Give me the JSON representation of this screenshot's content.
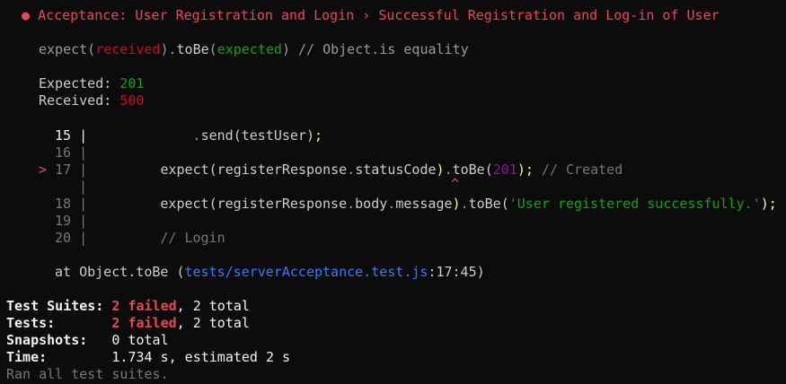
{
  "header": {
    "bullet": "●",
    "title": "Acceptance: User Registration and Login › Successful Registration and Log-in of User"
  },
  "matcher": {
    "expect": "expect(",
    "received": "received",
    "close_dot": ").",
    "tobe": "toBe",
    "open": "(",
    "expected": "expected",
    "close": ")",
    "comment": " // Object.is equality"
  },
  "values": {
    "expected_label": "Expected: ",
    "expected_value": "201",
    "received_label": "Received: ",
    "received_value": "500"
  },
  "code": {
    "line15_no": "15 |",
    "line15_dot": ".",
    "line15_send": "send",
    "line15_rest": "(testUser)",
    "line15_semi": ";",
    "line16_no": "16 |",
    "line17_marker": ">",
    "line17_no": "17 |",
    "line17_expect": "expect(registerResponse",
    "line17_dot1": ".",
    "line17_status": "statusCode",
    "line17_paren": ")",
    "line17_dot2": ".",
    "line17_tobe": "toBe(",
    "line17_num": "201",
    "line17_close": ");",
    "line17_comment": " // Created",
    "caret_gutter": "|",
    "caret": "^",
    "line18_no": "18 |",
    "line18_expect": "expect(registerResponse",
    "line18_dot1": ".",
    "line18_body": "body",
    "line18_dot2": ".",
    "line18_msg": "message",
    "line18_paren": ")",
    "line18_dot3": ".",
    "line18_tobe": "toBe(",
    "line18_str": "'User registered successfully.'",
    "line18_close": ");",
    "line19_no": "19 |",
    "line20_no": "20 |",
    "line20_comment": "// Login"
  },
  "stack": {
    "at": "at Object.toBe (",
    "path": "tests/serverAcceptance.test.js",
    "loc": ":17:45)"
  },
  "summary": {
    "suites_label": "Test Suites: ",
    "suites_failed": "2 failed",
    "suites_total": ", 2 total",
    "tests_label": "Tests:       ",
    "tests_failed": "2 failed",
    "tests_total": ", 2 total",
    "snapshots_label": "Snapshots:   ",
    "snapshots_value": "0 total",
    "time_label": "Time:        ",
    "time_value": "1.734 s, estimated 2 s",
    "ran": "Ran all test suites."
  },
  "colors": {
    "background": "#0c0c0c",
    "fail_red": "#e74856",
    "pass_green": "#13a10e",
    "link_blue": "#3b78ff"
  }
}
